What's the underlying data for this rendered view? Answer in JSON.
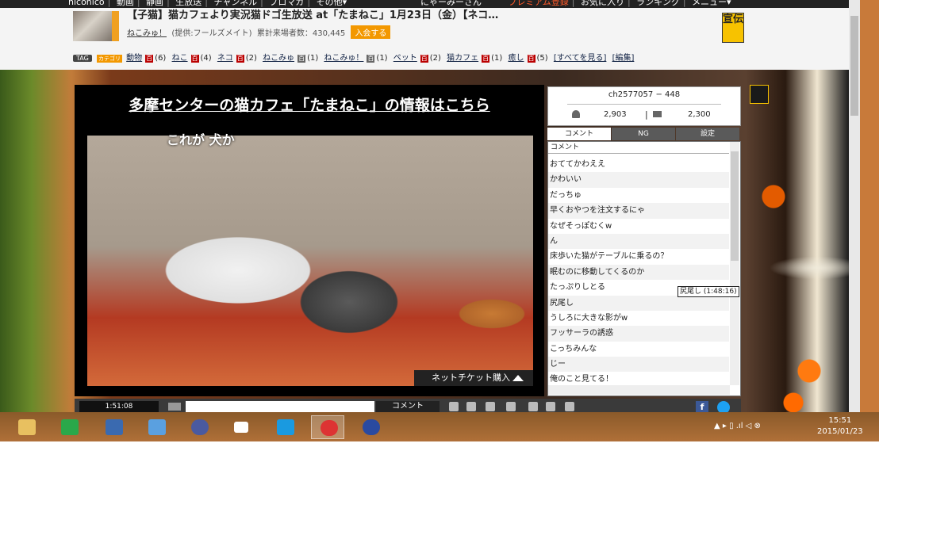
{
  "topnav": {
    "left_items": [
      "niconico",
      "動画",
      "静画",
      "生放送",
      "チャンネル",
      "ブロマガ",
      "その他▾"
    ],
    "user": "にゃーみーさん",
    "premium": "プレミアム登録",
    "right_items": [
      "お気に入り",
      "ランキング",
      "メニュー▾"
    ]
  },
  "stream": {
    "title": "【子猫】猫カフェより実況猫ドゴ生放送 at「たまねこ」1月23日（金）【ネコ…",
    "community": "ねこみゅ！",
    "provider": "(提供:フールズメイト)",
    "visitors_label": "累計来場者数：",
    "visitors": "430,445",
    "join_button": "入会する",
    "ad_badge": "宣伝"
  },
  "tags": {
    "tag_label": "TAG",
    "category_label": "カテゴリ",
    "items": [
      {
        "name": "動物",
        "count": "(6)",
        "category": true
      },
      {
        "name": "ねこ",
        "count": "(4)"
      },
      {
        "name": "ネコ",
        "count": "(2)"
      },
      {
        "name": "ねこみゅ",
        "count": "(1)"
      },
      {
        "name": "ねこみゅ！",
        "count": "(1)"
      },
      {
        "name": "ペット",
        "count": "(2)"
      },
      {
        "name": "猫カフェ",
        "count": "(1)"
      },
      {
        "name": "癒し",
        "count": "(5)"
      }
    ],
    "show_all": "[すべてを見る]",
    "edit": "[編集]"
  },
  "player": {
    "banner": "多摩センターの猫カフェ「たまねこ」の情報はこちら",
    "caption": "これが 犬か",
    "ticket_button": "ネットチケット購入",
    "time": "1:51:08",
    "comment_button": "コメント"
  },
  "stats": {
    "channel": "ch2577057 − 448",
    "viewers": "2,903",
    "comments": "2,300"
  },
  "panel_tabs": [
    "コメント",
    "NG",
    "設定"
  ],
  "comment_header": "コメント",
  "comments": [
    "おててかわええ",
    "かわいい",
    "だっちゅ",
    "早くおやつを注文するにゃ",
    "なぜそっぽむくw",
    "ん",
    "床歩いた猫がテーブルに乗るの？",
    "眠むのに移動してくるのか",
    "たっぷりしとる",
    "尻尾し",
    "うしろに大きな影がw",
    "フッサーラの誘惑",
    "こっちみんな",
    "じー",
    "俺のこと見てる！"
  ],
  "tooltip": "尻尾し (1:48:16)",
  "clock": {
    "time": "15:51",
    "date": "2015/01/23"
  },
  "tray": "▲ ▸ ▯ .ıl ◁ ⊗"
}
